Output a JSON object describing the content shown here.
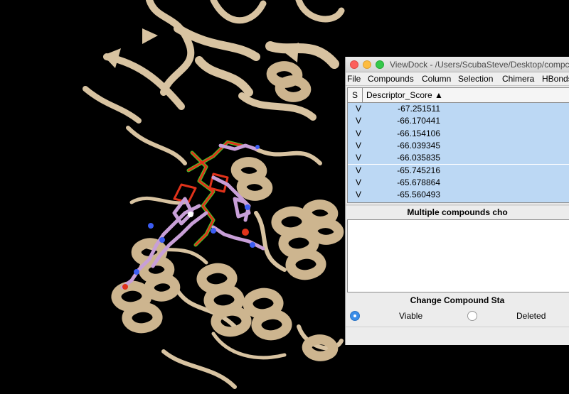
{
  "window": {
    "title": "ViewDock - /Users/ScubaSteve/Desktop/compche"
  },
  "menu": {
    "items": [
      "File",
      "Compounds",
      "Column",
      "Selection",
      "Chimera",
      "HBonds"
    ]
  },
  "table": {
    "columns": [
      "S",
      "Descriptor_Score ▲"
    ],
    "rows": [
      {
        "status": "V",
        "score": "-67.251511"
      },
      {
        "status": "V",
        "score": "-66.170441"
      },
      {
        "status": "V",
        "score": "-66.154106"
      },
      {
        "status": "V",
        "score": "-66.039345"
      },
      {
        "status": "V",
        "score": "-66.035835"
      },
      {
        "status": "V",
        "score": "-65.745216"
      },
      {
        "status": "V",
        "score": "-65.678864"
      },
      {
        "status": "V",
        "score": "-65.560493"
      }
    ]
  },
  "info": {
    "title": "Multiple compounds cho"
  },
  "status_change": {
    "title": "Change Compound Sta",
    "options": [
      {
        "label": "Viable",
        "selected": true
      },
      {
        "label": "Deleted",
        "selected": false
      }
    ]
  },
  "colors": {
    "protein": "#d8c3a1",
    "ligand": "#c89fd8",
    "reference_ligand": "#e0321a",
    "selection_outline": "#3fd22a",
    "row_highlight": "#bcd8f4"
  }
}
